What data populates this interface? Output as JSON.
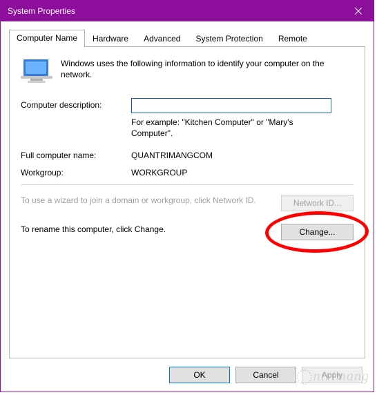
{
  "window": {
    "title": "System Properties"
  },
  "tabs": {
    "computer_name": "Computer Name",
    "hardware": "Hardware",
    "advanced": "Advanced",
    "system_protection": "System Protection",
    "remote": "Remote"
  },
  "intro": "Windows uses the following information to identify your computer on the network.",
  "fields": {
    "description_label": "Computer description:",
    "description_value": "",
    "description_example": "For example: \"Kitchen Computer\" or \"Mary's Computer\".",
    "full_name_label": "Full computer name:",
    "full_name_value": "QUANTRIMANGCOM",
    "workgroup_label": "Workgroup:",
    "workgroup_value": "WORKGROUP"
  },
  "wizard": {
    "text": "To use a wizard to join a domain or workgroup, click Network ID.",
    "button": "Network ID..."
  },
  "rename": {
    "text": "To rename this computer, click Change.",
    "button": "Change..."
  },
  "buttons": {
    "ok": "OK",
    "cancel": "Cancel",
    "apply": "Apply"
  },
  "watermark": "ntrimang"
}
